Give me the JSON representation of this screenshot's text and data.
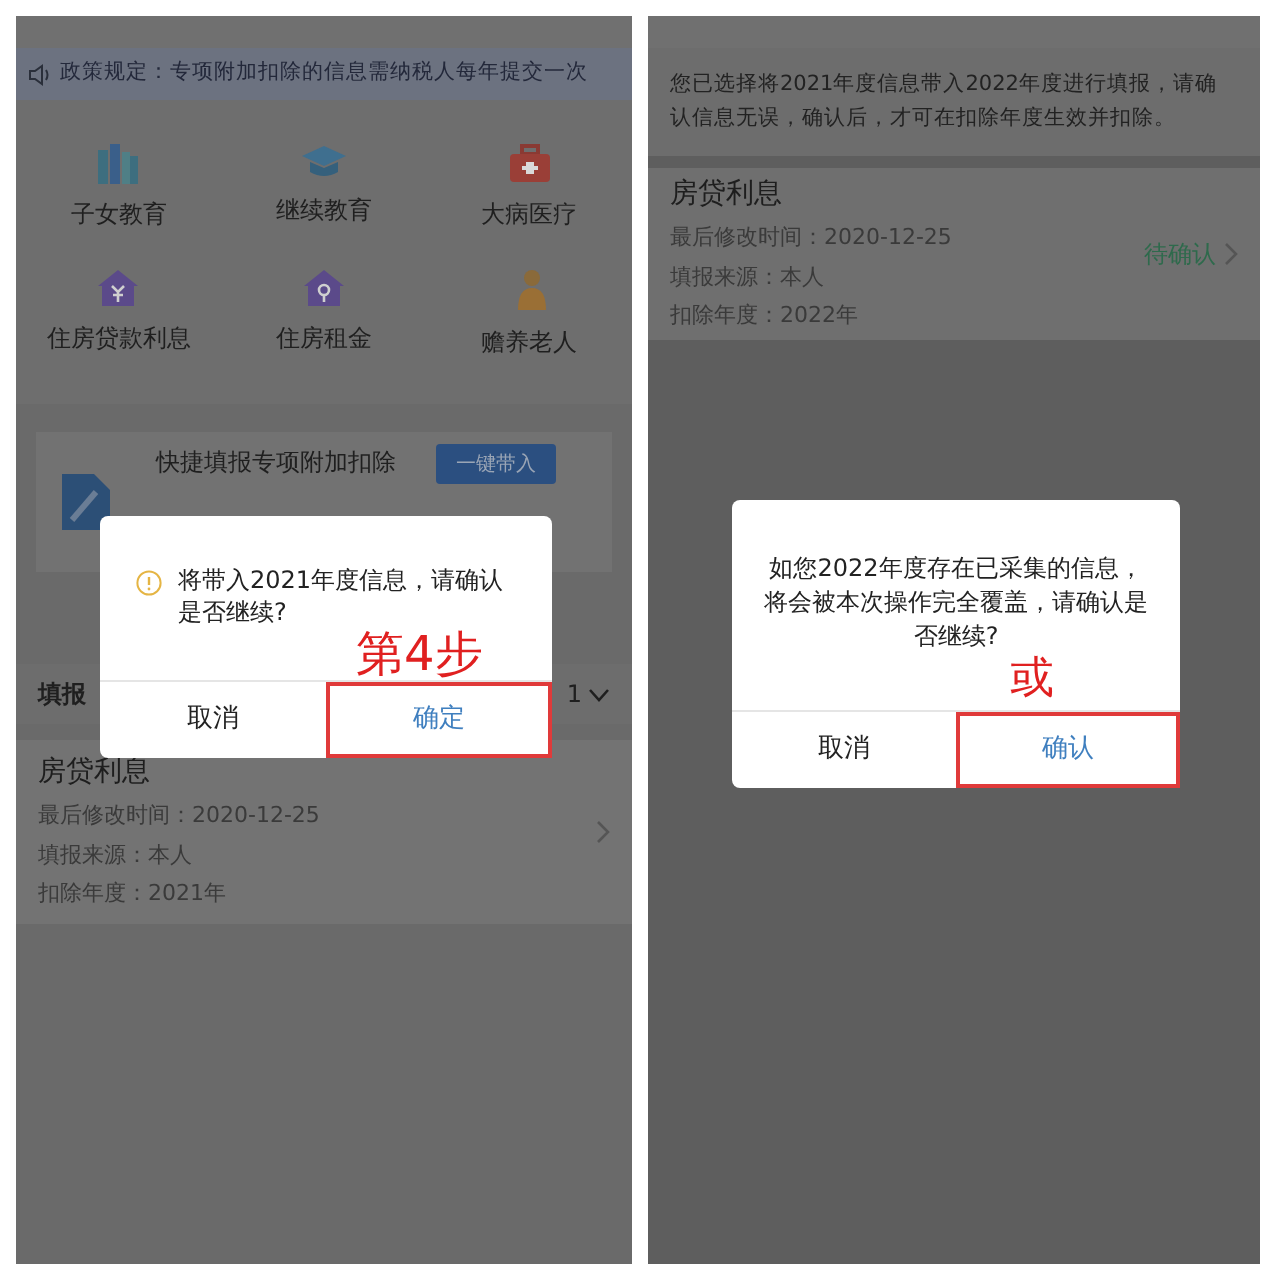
{
  "panels": [
    {
      "notice": "政策规定：专项附加扣除的信息需纳税人每年提交一次",
      "categories": [
        {
          "label": "子女教育"
        },
        {
          "label": "继续教育"
        },
        {
          "label": "大病医疗"
        },
        {
          "label": "住房贷款利息"
        },
        {
          "label": "住房租金"
        },
        {
          "label": "赡养老人"
        }
      ],
      "quick_fill": {
        "title": "快捷填报专项附加扣除",
        "button": "一键带入"
      },
      "records_header": {
        "label": "填报",
        "value": "1"
      },
      "record": {
        "title": "房贷利息",
        "lines": [
          "最后修改时间：2020-12-25",
          "填报来源：本人",
          "扣除年度：2021年"
        ]
      },
      "dialog": {
        "message": "将带入2021年度信息，请确认是否继续?",
        "buttons": [
          {
            "label": "取消",
            "highlighted": false
          },
          {
            "label": "确定",
            "highlighted": true
          }
        ]
      },
      "annotation": "第4步"
    },
    {
      "notice": "您已选择将2021年度信息带入2022年度进行填报，请确认信息无误，确认后，才可在扣除年度生效并扣除。",
      "record": {
        "title": "房贷利息",
        "lines": [
          "最后修改时间：2020-12-25",
          "填报来源：本人",
          "扣除年度：2022年"
        ],
        "status": "待确认"
      },
      "dialog": {
        "message": "如您2022年度存在已采集的信息，将会被本次操作完全覆盖，请确认是否继续?",
        "buttons": [
          {
            "label": "取消",
            "highlighted": false
          },
          {
            "label": "确认",
            "highlighted": true
          }
        ]
      },
      "annotation": "或"
    }
  ]
}
